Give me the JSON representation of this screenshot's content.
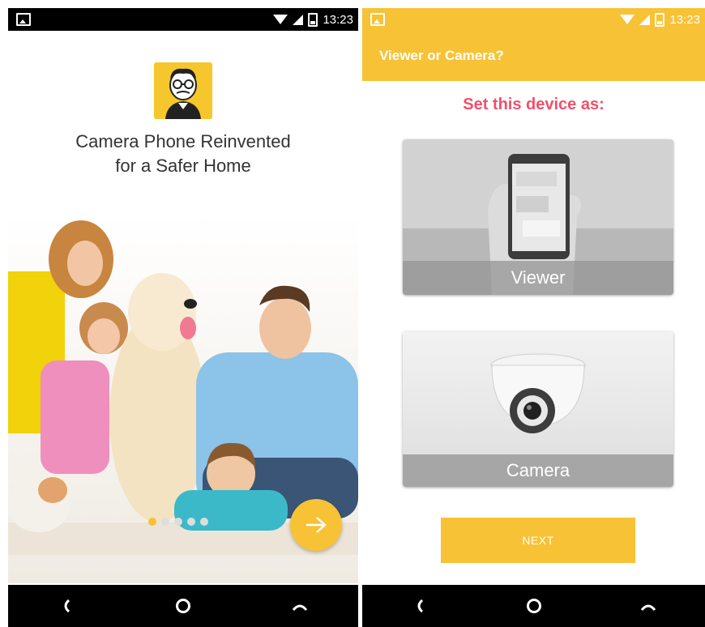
{
  "left_screen": {
    "status": {
      "time": "13:23"
    },
    "tagline_line1": "Camera Phone Reinvented",
    "tagline_line2": "for a Safer Home",
    "pager": {
      "count": 5,
      "active_index": 0
    }
  },
  "right_screen": {
    "status": {
      "time": "13:23"
    },
    "appbar_title": "Viewer or Camera?",
    "heading": "Set this device as:",
    "options": [
      {
        "label": "Viewer"
      },
      {
        "label": "Camera"
      }
    ],
    "next_label": "NEXT"
  },
  "colors": {
    "accent": "#f8c236",
    "heading": "#f0506a",
    "navbar": "#000000"
  }
}
